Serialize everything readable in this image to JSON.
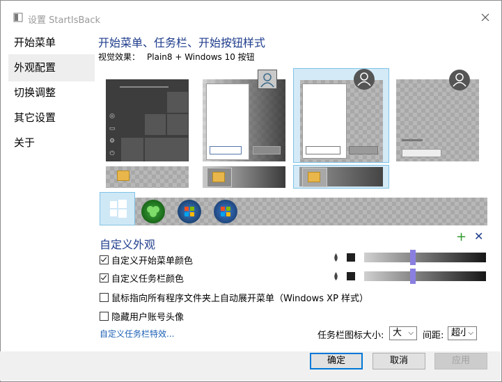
{
  "window": {
    "title": "设置 StartIsBack"
  },
  "sidebar": {
    "items": [
      {
        "label": "开始菜单"
      },
      {
        "label": "外观配置"
      },
      {
        "label": "切换调整"
      },
      {
        "label": "其它设置"
      },
      {
        "label": "关于"
      }
    ]
  },
  "appearance": {
    "heading": "开始菜单、任务栏、开始按钮样式",
    "visual_label": "视觉效果：",
    "visual_value": "Plain8 + Windows 10 按钮"
  },
  "custom": {
    "heading": "自定义外观",
    "checkboxes": [
      {
        "label": "自定义开始菜单颜色",
        "checked": true
      },
      {
        "label": "自定义任务栏颜色",
        "checked": true
      },
      {
        "label": "鼠标指向所有程序文件夹上自动展开菜单（Windows XP 样式）",
        "checked": false
      },
      {
        "label": "隐藏用户账号头像",
        "checked": false
      }
    ],
    "effects_link": "自定义任务栏特效...",
    "icon_size_label": "任务栏图标大小:",
    "icon_size_value": "大",
    "spacing_label": "间距:",
    "spacing_value": "超小"
  },
  "buttons": {
    "ok": "确定",
    "cancel": "取消",
    "apply": "应用"
  },
  "colors": {
    "accent": "#1e3c8c",
    "link": "#1a5fb4",
    "slider_thumb": "#8a7fe0"
  }
}
